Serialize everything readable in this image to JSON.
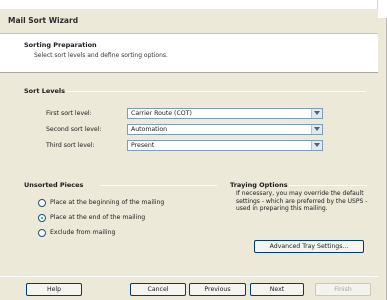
{
  "window": {
    "title": "Mail Sort Wizard"
  },
  "header": {
    "title": "Sorting Preparation",
    "subtitle": "Select sort levels and define sorting options."
  },
  "sort_levels": {
    "title": "Sort Levels",
    "first_label": "First sort level:",
    "first_value": "Carrier Route (COT)",
    "second_label": "Second sort level:",
    "second_value": "Automation",
    "third_label": "Third sort level:",
    "third_value": "Present"
  },
  "unsorted_pieces": {
    "title": "Unsorted Pieces",
    "options": [
      "Place at the beginning of the mailing",
      "Place at the end of the mailing",
      "Exclude from mailing"
    ],
    "selected_index": 1
  },
  "traying": {
    "title": "Traying Options",
    "text": "If necessary, you may override the default settings - which are preferred by the USPS - used in preparing this mailing.",
    "button": "Advanced Tray Settings..."
  },
  "footer": {
    "help": "Help",
    "cancel": "Cancel",
    "previous": "Previous",
    "next": "Next",
    "finish": "Finish"
  },
  "icons": {
    "dropdown": "chevron-down-icon",
    "radio_selected_color": "#21a121"
  }
}
